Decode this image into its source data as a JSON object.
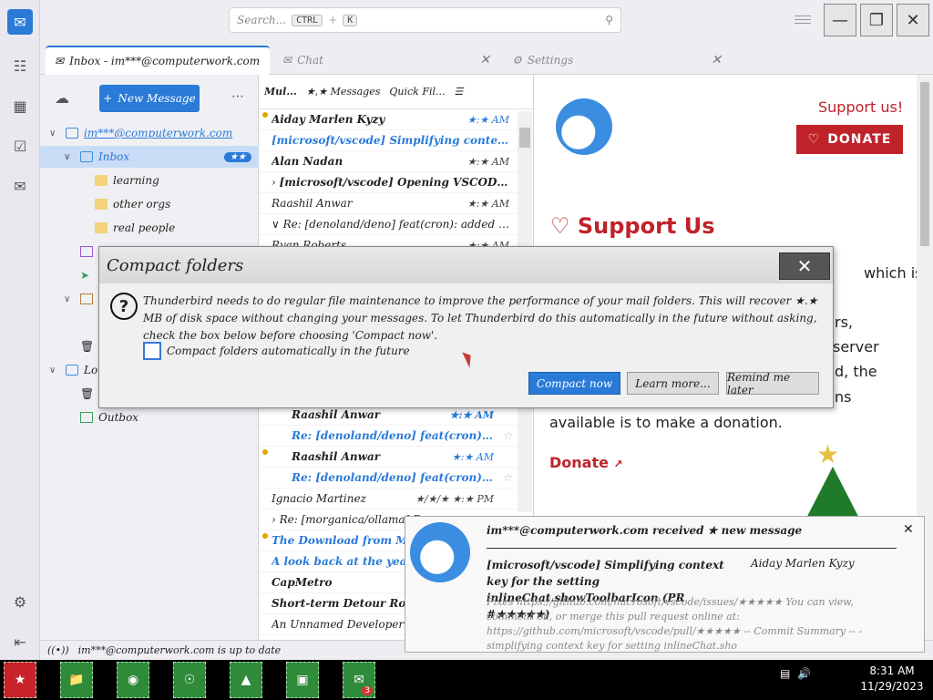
{
  "search": {
    "placeholder": "Search...",
    "kbd1": "CTRL",
    "kbd2": "K"
  },
  "tabs": [
    {
      "label": "Inbox - im***@computerwork.com"
    },
    {
      "label": "Chat"
    },
    {
      "label": "Settings"
    }
  ],
  "folder_pane": {
    "new_message": "New Message",
    "account": "im***@computerwork.com",
    "inbox": "Inbox",
    "inbox_unread": "★★",
    "subfolders": [
      "learning",
      "other orgs",
      "real people"
    ],
    "local_folders_label": "Lo",
    "outbox": "Outbox"
  },
  "thread_pane": {
    "toolbar_label": "Mul...",
    "messages_count": "★,★ Messages",
    "quick_filter": "Quick Fil...",
    "rows": [
      {
        "sender": "Aiday Marlen Kyzy",
        "date": "★:★ AM",
        "unread": true
      },
      {
        "subject": "[microsoft/vscode] Simplifying context key for...",
        "blue": true
      },
      {
        "sender": "Alan Nadan",
        "date": "★:★ AM"
      },
      {
        "subject": "[microsoft/vscode] Opening VSCODE...",
        "thread": true
      },
      {
        "sender": "Raashil Anwar",
        "date": "★:★ AM"
      },
      {
        "subject": "Re: [denoland/deno] feat(cron): added the ..."
      },
      {
        "sender": "Ryan Roberts",
        "date": "★:★ AM"
      }
    ],
    "rows_lower": [
      {
        "sender": "Raashil Anwar",
        "date": "★:★ AM",
        "blue": true
      },
      {
        "subject": "Re: [denoland/deno] feat(cron): added...",
        "blue": true
      },
      {
        "sender": "Raashil Anwar",
        "date": "★:★ AM",
        "unread": true
      },
      {
        "subject": "Re: [denoland/deno] feat(cron): added...",
        "blue": true
      },
      {
        "sender": "Ignacio Martinez",
        "date": "★/★/★ ★:★ PM"
      },
      {
        "subject": "Re: [morganica/ollama] R...",
        "thread": true
      },
      {
        "sender": "The Download from MIT T...",
        "blue": true,
        "unread": true
      },
      {
        "subject": "A look back at the year's ...",
        "blue": true
      },
      {
        "sender": "CapMetro"
      },
      {
        "subject": "Short-term Detour Route ..."
      },
      {
        "sender": "An Unnamed Developer"
      }
    ]
  },
  "message_pane": {
    "support_link": "Support us!",
    "donate_button": "DONATE",
    "heading": "Support Us",
    "body_fragments": [
      "which is",
      "rs,",
      "server",
      "d, the",
      "ns",
      "available is to make a donation."
    ],
    "donate_link": "Donate"
  },
  "status_bar": {
    "text": "im***@computerwork.com is up to date"
  },
  "dialog": {
    "title": "Compact folders",
    "message": "Thunderbird needs to do regular file maintenance to improve the performance of your mail folders. This will recover ★.★ MB of disk space without changing your messages. To let Thunderbird do this automatically in the future without asking, check the box below before choosing 'Compact now'.",
    "checkbox_label": "Compact folders automatically in the future",
    "btn_compact": "Compact now",
    "btn_learn": "Learn more...",
    "btn_remind": "Remind me later"
  },
  "notification": {
    "title": "im***@computerwork.com received ★ new message",
    "subject": "[microsoft/vscode] Simplifying context key for the setting inlineChat.showToolbarIcon (PR #★★★★★)",
    "sender": "Aiday Marlen Kyzy",
    "body": "Fixes https://github.com/microsoft/vscode/issues/★★★★★ You can view, comment on, or merge this pull request online at: https://github.com/microsoft/vscode/pull/★★★★★ -- Commit Summary -- - simplifying context key for setting inlineChat.sho"
  },
  "taskbar": {
    "time": "8:31 AM",
    "date": "11/29/2023",
    "tb_badge": "3"
  }
}
